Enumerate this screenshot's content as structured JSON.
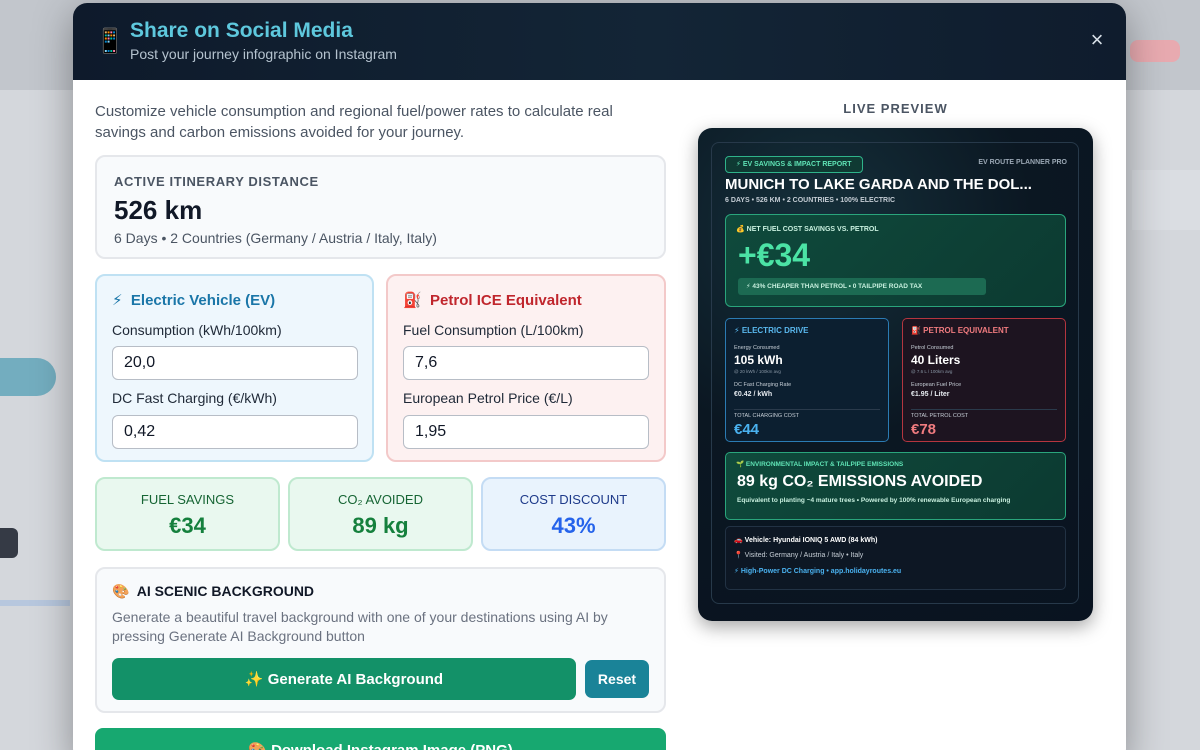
{
  "modal": {
    "icon": "📱",
    "title": "Share on Social Media",
    "subtitle": "Post your journey infographic on Instagram",
    "close": "×"
  },
  "intro": "Customize vehicle consumption and regional fuel/power rates to calculate real savings and carbon emissions avoided for your journey.",
  "distance": {
    "label": "ACTIVE ITINERARY DISTANCE",
    "value": "526 km",
    "meta": "6 Days • 2 Countries (Germany / Austria / Italy, Italy)"
  },
  "ev": {
    "icon": "⚡",
    "title": "Electric Vehicle (EV)",
    "consumption_label": "Consumption (kWh/100km)",
    "consumption_value": "20,0",
    "price_label": "DC Fast Charging (€/kWh)",
    "price_value": "0,42"
  },
  "ice": {
    "icon": "⛽",
    "title": "Petrol ICE Equivalent",
    "consumption_label": "Fuel Consumption (L/100km)",
    "consumption_value": "7,6",
    "price_label": "European Petrol Price (€/L)",
    "price_value": "1,95"
  },
  "stats": {
    "fuel_label": "FUEL SAVINGS",
    "fuel_value": "€34",
    "co2_label": "CO₂ AVOIDED",
    "co2_value": "89 kg",
    "cost_label": "COST DISCOUNT",
    "cost_value": "43%"
  },
  "ai": {
    "icon": "🎨",
    "title": "AI SCENIC BACKGROUND",
    "description": "Generate a beautiful travel background with one of your destinations using AI by pressing Generate AI Background button",
    "generate_label": "✨  Generate AI Background",
    "reset_label": "Reset"
  },
  "download_label": "🎨  Download Instagram Image (PNG)",
  "preview": {
    "label": "LIVE PREVIEW",
    "tag": "⚡ EV SAVINGS & IMPACT REPORT",
    "brand": "EV ROUTE PLANNER PRO",
    "route": "MUNICH TO LAKE GARDA AND THE DOL...",
    "route_meta": "6 DAYS • 526 KM • 2 COUNTRIES • 100% ELECTRIC",
    "savings_label": "💰 NET FUEL COST SAVINGS VS. PETROL",
    "savings_value": "+€34",
    "savings_pill": "⚡ 43% CHEAPER THAN PETROL • 0 TAILPIPE ROAD TAX",
    "ev": {
      "title": "⚡ ELECTRIC DRIVE",
      "energy_label": "Energy Consumed",
      "energy_value": "105 kWh",
      "energy_sub": "@ 20 kWh / 100km avg",
      "rate_label": "DC Fast Charging Rate",
      "rate_value": "€0.42 / kWh",
      "total_label": "TOTAL CHARGING COST",
      "total_value": "€44"
    },
    "petrol": {
      "title": "⛽ PETROL EQUIVALENT",
      "energy_label": "Petrol Consumed",
      "energy_value": "40 Liters",
      "energy_sub": "@ 7.6 L / 100km avg",
      "rate_label": "European Fuel Price",
      "rate_value": "€1.95 / Liter",
      "total_label": "TOTAL PETROL COST",
      "total_value": "€78"
    },
    "env_label": "🌱 ENVIRONMENTAL IMPACT & TAILPIPE EMISSIONS",
    "env_value": "89 kg CO₂ EMISSIONS AVOIDED",
    "env_desc": "Equivalent to planting ~4 mature trees • Powered by 100% renewable European charging",
    "vehicle": "🚗 Vehicle: Hyundai IONIQ 5 AWD (84 kWh)",
    "visited": "📍 Visited: Germany / Austria / Italy • Italy",
    "charging": "⚡ High-Power DC Charging • app.holidayroutes.eu"
  },
  "colors": {
    "header_bg": "#0e1a2b",
    "title_accent": "#5ec8dd",
    "ev_blue": "#1a76a8",
    "petrol_red": "#c0262d",
    "green": "#15803d",
    "button_green": "#139168",
    "reset_teal": "#1a8398"
  }
}
